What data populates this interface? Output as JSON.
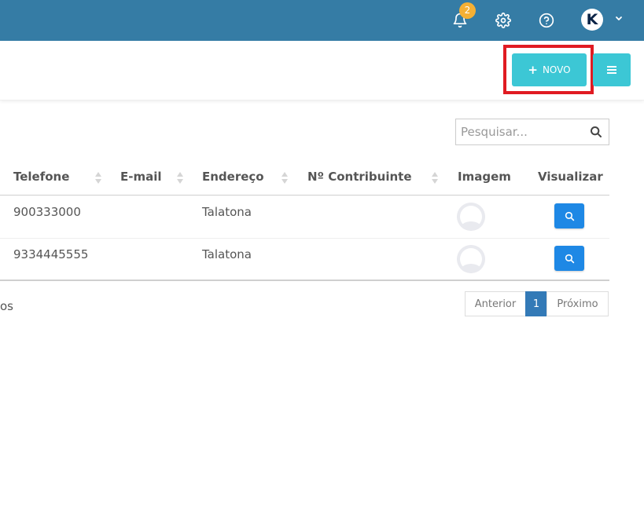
{
  "topbar": {
    "notification_count": "2",
    "icons": [
      "bell-icon",
      "gear-icon",
      "help-icon",
      "user-avatar",
      "chevron-down-icon"
    ],
    "color": "#357ca5"
  },
  "toolbar": {
    "new_label": "NOVO",
    "new_icon": "+",
    "accent": "#3cc7d5",
    "highlight": "#e01b22"
  },
  "search": {
    "placeholder": "Pesquisar..."
  },
  "table": {
    "columns": [
      "Telefone",
      "E-mail",
      "Endereço",
      "Nº Contribuinte",
      "Imagem",
      "Visualizar"
    ],
    "rows": [
      {
        "telefone": "900333000",
        "email": "",
        "endereco": "Talatona",
        "contribuinte": ""
      },
      {
        "telefone": "9334445555",
        "email": "",
        "endereco": "Talatona",
        "contribuinte": ""
      }
    ]
  },
  "footer": {
    "info_fragment": "os"
  },
  "pagination": {
    "prev": "Anterior",
    "current": "1",
    "next": "Próximo",
    "active_color": "#337ab7"
  }
}
